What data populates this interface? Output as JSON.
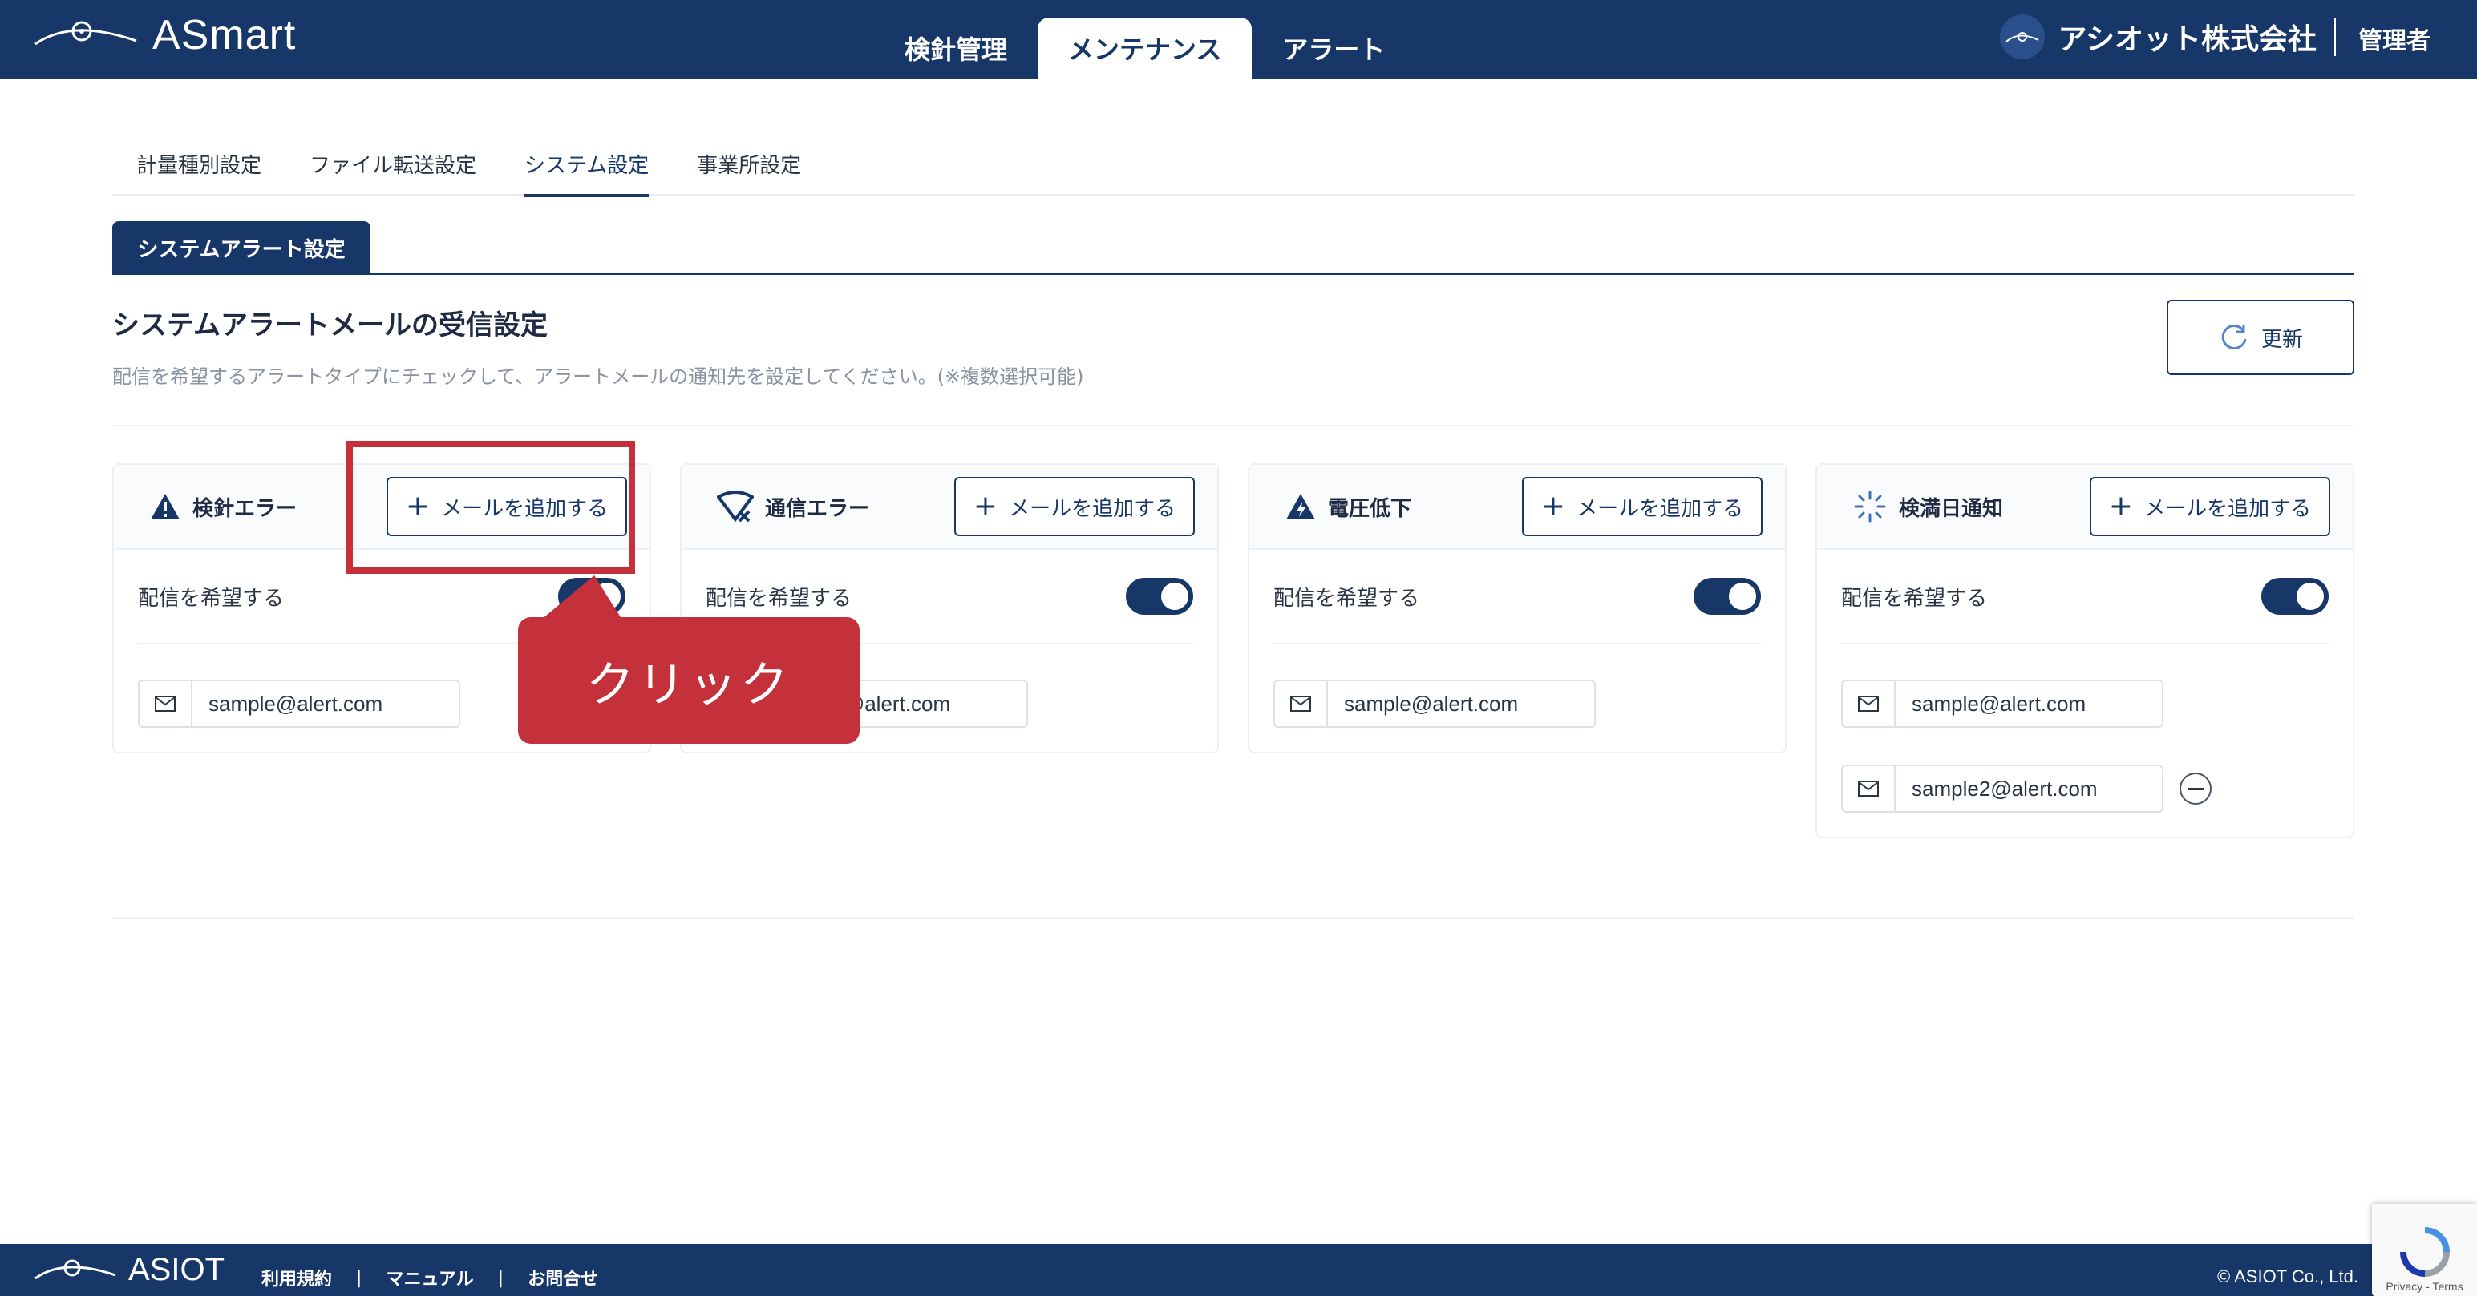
{
  "header": {
    "logo_text": "ASmart",
    "tabs": [
      {
        "label": "検針管理"
      },
      {
        "label": "メンテナンス"
      },
      {
        "label": "アラート"
      }
    ],
    "company_name": "アシオット株式会社",
    "user_role": "管理者"
  },
  "sub_tabs": [
    {
      "label": "計量種別設定"
    },
    {
      "label": "ファイル転送設定"
    },
    {
      "label": "システム設定"
    },
    {
      "label": "事業所設定"
    }
  ],
  "section_tab": "システムアラート設定",
  "page": {
    "title": "システムアラートメールの受信設定",
    "description": "配信を希望するアラートタイプにチェックして、アラートメールの通知先を設定してください。(※複数選択可能)",
    "refresh_label": "更新"
  },
  "cards": [
    {
      "title": "検針エラー",
      "icon": "warning-icon",
      "add_label": "メールを追加する",
      "toggle_label": "配信を希望する",
      "toggle_on": true,
      "emails": [
        "sample@alert.com"
      ]
    },
    {
      "title": "通信エラー",
      "icon": "signal-error-icon",
      "add_label": "メールを追加する",
      "toggle_label": "配信を希望する",
      "toggle_on": true,
      "emails": [
        "sample@alert.com"
      ]
    },
    {
      "title": "電圧低下",
      "icon": "voltage-warning-icon",
      "add_label": "メールを追加する",
      "toggle_label": "配信を希望する",
      "toggle_on": true,
      "emails": [
        "sample@alert.com"
      ]
    },
    {
      "title": "検満日通知",
      "icon": "notification-burst-icon",
      "add_label": "メールを追加する",
      "toggle_label": "配信を希望する",
      "toggle_on": true,
      "emails": [
        "sample@alert.com",
        "sample2@alert.com"
      ]
    }
  ],
  "annotation": {
    "callout_text": "クリック"
  },
  "footer": {
    "logo_text": "ASIOT",
    "links": [
      {
        "label": "利用規約"
      },
      {
        "label": "マニュアル"
      },
      {
        "label": "お問合せ"
      }
    ],
    "copyright": "© ASIOT Co., Ltd.",
    "recaptcha_text": "Privacy - Terms"
  },
  "colors": {
    "primary": "#173768",
    "annotation": "#c4313a",
    "background": "#ffffff"
  }
}
